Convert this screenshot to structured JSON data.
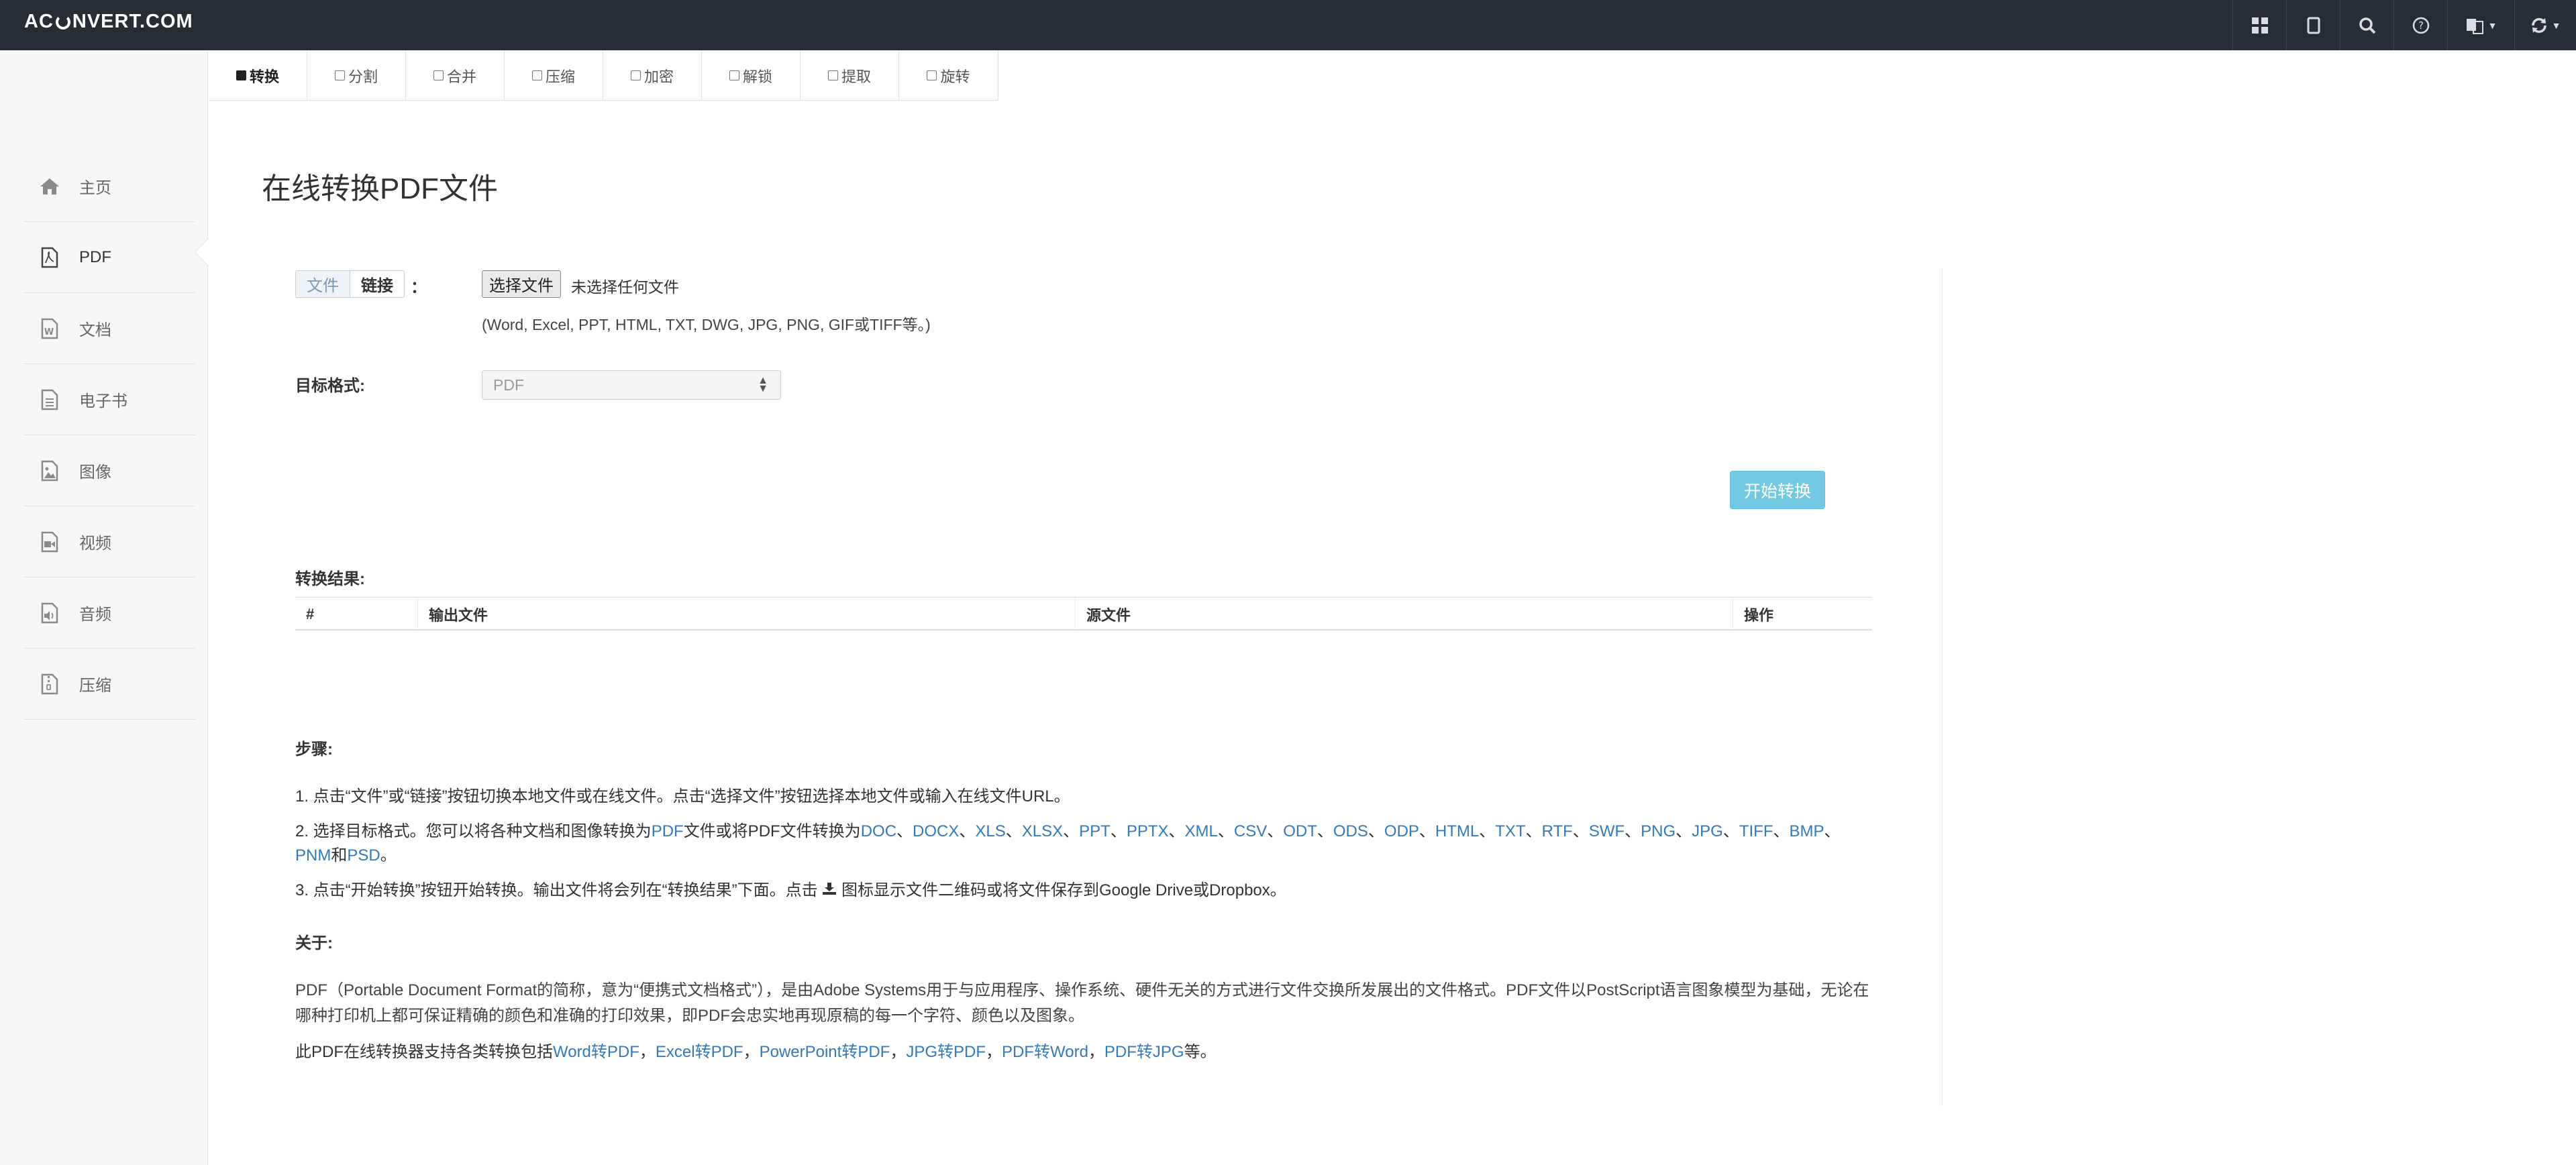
{
  "navbar": {
    "brand_left": "AC",
    "brand_right": "NVERT.COM",
    "icons": [
      "grid-icon",
      "bookmark-icon",
      "search-icon",
      "help-icon",
      "language-icon",
      "refresh-icon"
    ]
  },
  "sidebar": {
    "items": [
      {
        "label": "主页",
        "icon": "home-icon"
      },
      {
        "label": "PDF",
        "icon": "pdf-icon"
      },
      {
        "label": "文档",
        "icon": "document-icon"
      },
      {
        "label": "电子书",
        "icon": "ebook-icon"
      },
      {
        "label": "图像",
        "icon": "image-icon"
      },
      {
        "label": "视频",
        "icon": "video-icon"
      },
      {
        "label": "音频",
        "icon": "audio-icon"
      },
      {
        "label": "压缩",
        "icon": "archive-icon"
      }
    ]
  },
  "tabs": [
    "转换",
    "分割",
    "合并",
    "压缩",
    "加密",
    "解锁",
    "提取",
    "旋转"
  ],
  "main": {
    "title": "在线转换PDF文件",
    "source_toggle": {
      "file": "文件",
      "link": "链接",
      "colon": "："
    },
    "file_button": "选择文件",
    "file_none": "未选择任何文件",
    "hint": "(Word, Excel, PPT, HTML, TXT, DWG, JPG, PNG, GIF或TIFF等。)",
    "target_label": "目标格式:",
    "target_value": "PDF",
    "start_button": "开始转换",
    "results_label": "转换结果:",
    "table_headers": [
      "#",
      "输出文件",
      "源文件",
      "操作"
    ],
    "steps_label": "步骤:",
    "step1": "1. 点击“文件”或“链接”按钮切换本地文件或在线文件。点击“选择文件”按钮选择本地文件或输入在线文件URL。",
    "step2_prefix": "2. 选择目标格式。您可以将各种文档和图像转换为",
    "step2_pdf": "PDF",
    "step2_middle": "文件或将PDF文件转换为",
    "step2_formats": [
      "DOC",
      "DOCX",
      "XLS",
      "XLSX",
      "PPT",
      "PPTX",
      "XML",
      "CSV",
      "ODT",
      "ODS",
      "ODP",
      "HTML",
      "TXT",
      "RTF",
      "SWF",
      "PNG",
      "JPG",
      "TIFF",
      "BMP",
      "PNM"
    ],
    "step2_sep": "、",
    "step2_and": "和",
    "step2_last": "PSD",
    "step2_end": "。",
    "step3_a": "3. 点击“开始转换”按钮开始转换。输出文件将会列在“转换结果”下面。点击",
    "step3_b": "图标显示文件二维码或将文件保存到Google Drive或Dropbox。",
    "about_label": "关于:",
    "about_text": "PDF（Portable Document Format的简称，意为“便携式文档格式”），是由Adobe Systems用于与应用程序、操作系统、硬件无关的方式进行文件交换所发展出的文件格式。PDF文件以PostScript语言图象模型为基础，无论在哪种打印机上都可保证精确的颜色和准确的打印效果，即PDF会忠实地再现原稿的每一个字符、颜色以及图象。",
    "support_prefix": "此PDF在线转换器支持各类转换包括",
    "support_links": [
      "Word转PDF",
      "Excel转PDF",
      "PowerPoint转PDF",
      "JPG转PDF",
      "PDF转Word",
      "PDF转JPG"
    ],
    "support_sep": "，",
    "support_end": "等。"
  }
}
